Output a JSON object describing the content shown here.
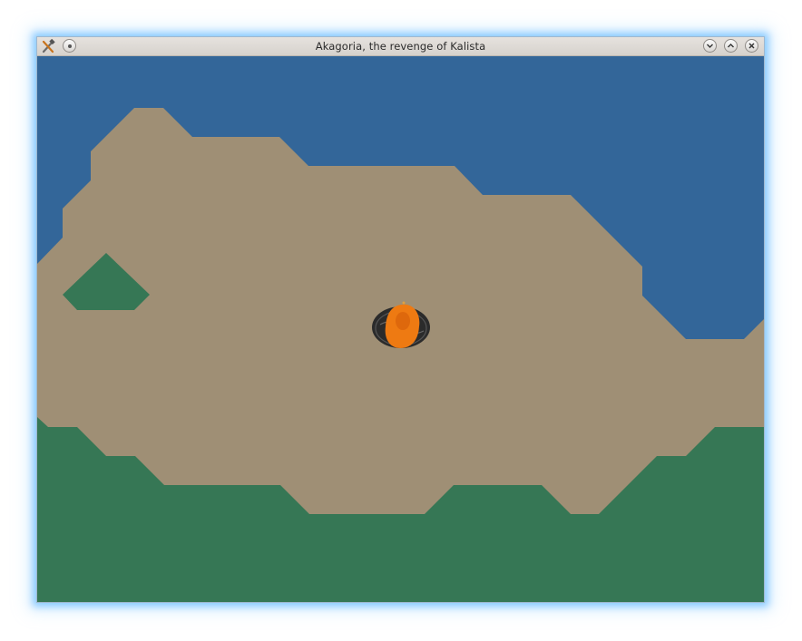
{
  "window": {
    "title": "Akagoria, the revenge of Kalista"
  },
  "titlebar": {
    "left_buttons": [
      {
        "name": "app-menu-icon"
      },
      {
        "name": "sticky-button"
      }
    ],
    "right_buttons": [
      {
        "name": "minimize-button",
        "glyph": "⌄"
      },
      {
        "name": "maximize-button",
        "glyph": "⌃"
      },
      {
        "name": "close-button",
        "glyph": "✕"
      }
    ]
  },
  "map": {
    "terrain_colors": {
      "water": "#336699",
      "sand": "#9f8f75",
      "grass": "#367755"
    },
    "character": {
      "body_color": "#ee7a12",
      "shadow_color": "#2b2b2b"
    }
  }
}
